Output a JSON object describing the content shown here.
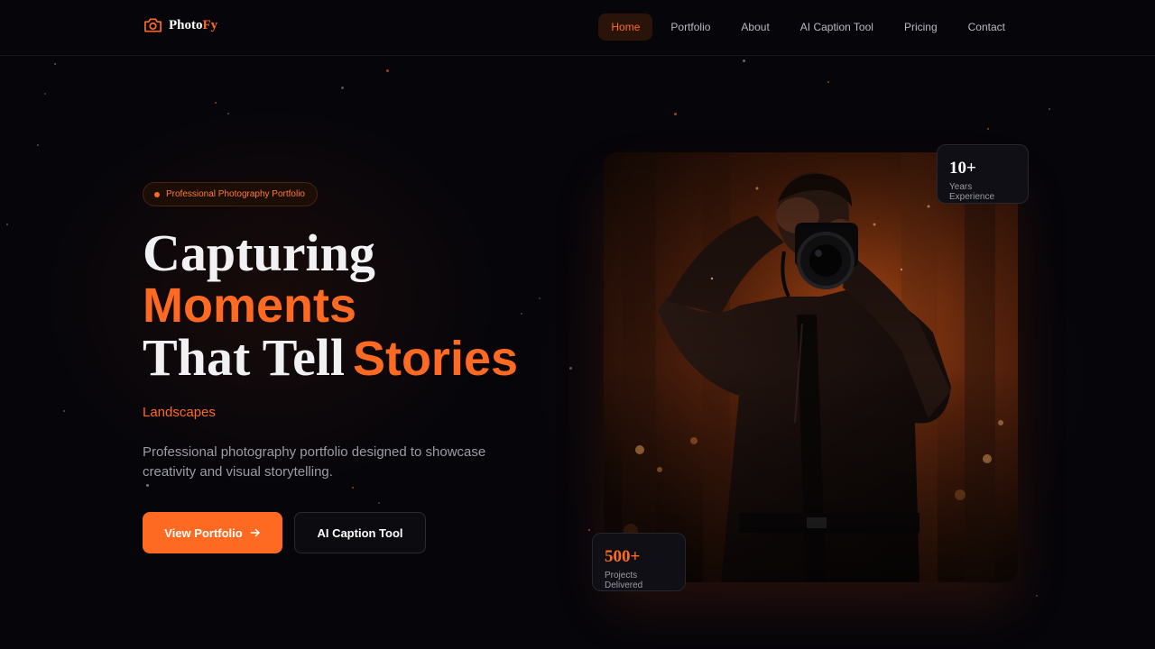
{
  "brand": {
    "name_main": "Photo",
    "name_accent": "Fy"
  },
  "nav": {
    "items": [
      {
        "label": "Home",
        "active": true
      },
      {
        "label": "Portfolio",
        "active": false
      },
      {
        "label": "About",
        "active": false
      },
      {
        "label": "AI Caption Tool",
        "active": false
      },
      {
        "label": "Pricing",
        "active": false
      },
      {
        "label": "Contact",
        "active": false
      }
    ]
  },
  "hero": {
    "tag": "Professional Photography Portfolio",
    "headline": {
      "line1": "Capturing",
      "line2": "Moments",
      "line3_white": "That Tell",
      "line3_orange": "Stories"
    },
    "rotating_word": "Landscapes",
    "description": "Professional photography portfolio designed to showcase creativity and visual storytelling.",
    "primary_button": "View Portfolio",
    "primary_button_icon": "arrow-right-icon",
    "secondary_button": "AI Caption Tool"
  },
  "stats": {
    "experience": {
      "value": "10+",
      "label": "Years Experience"
    },
    "projects": {
      "value": "500+",
      "label": "Projects Delivered"
    }
  },
  "colors": {
    "accent": "#ff6a22",
    "background": "#05050a",
    "card": "#0f0f15"
  }
}
